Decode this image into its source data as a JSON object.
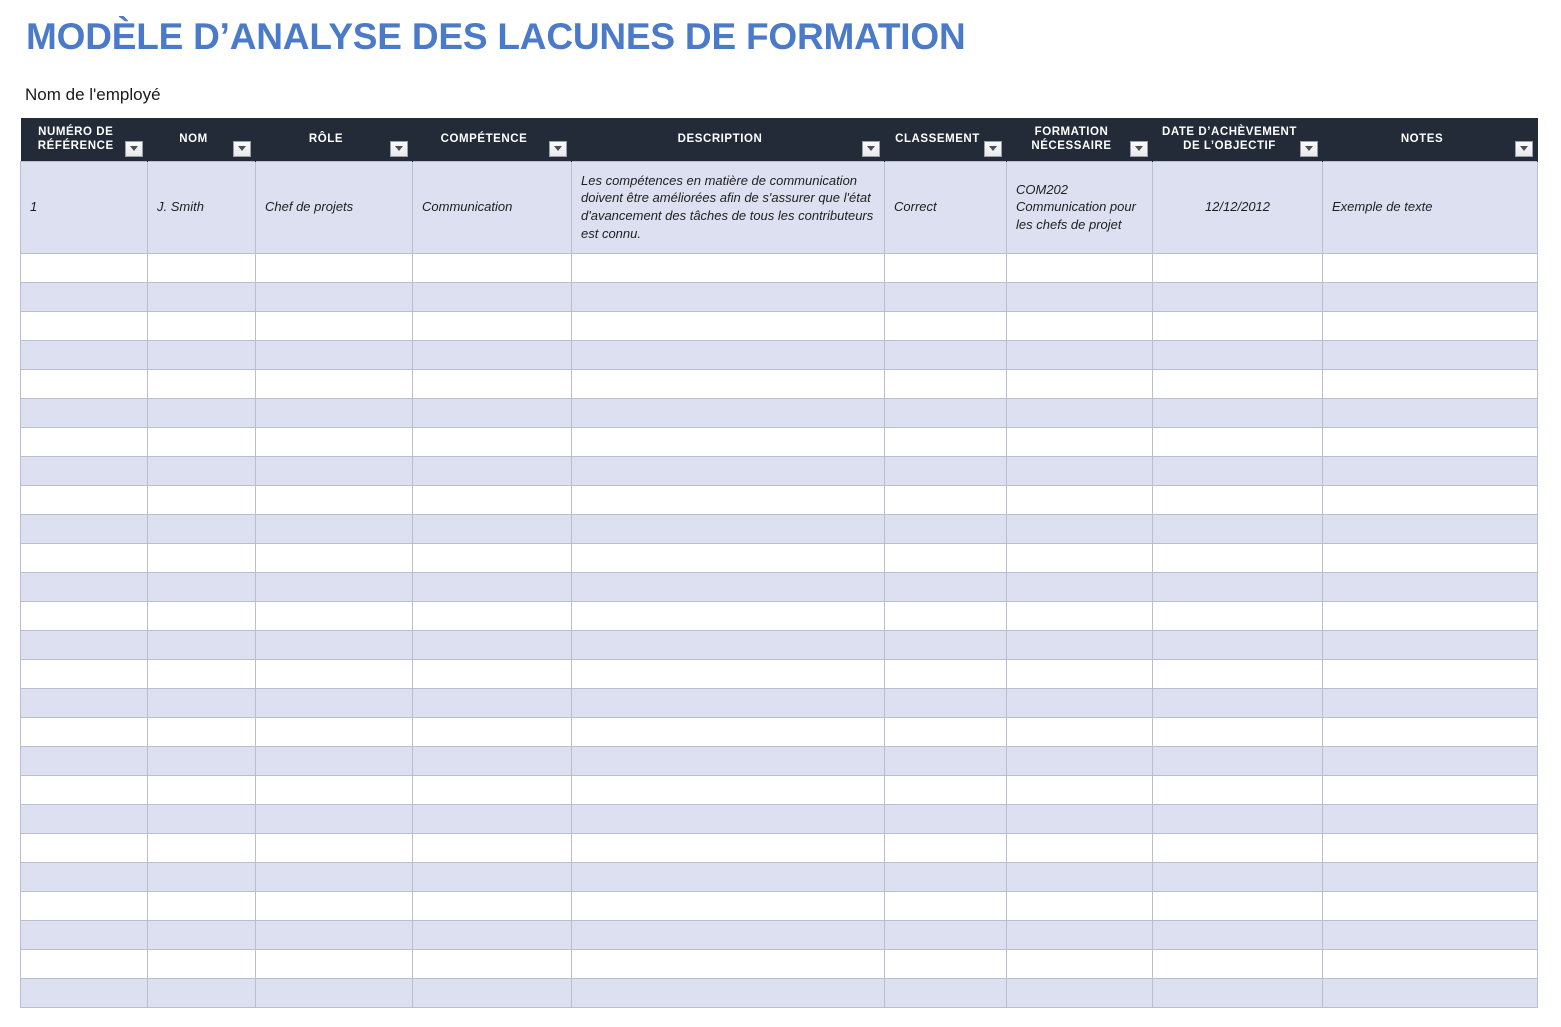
{
  "document": {
    "title": "MODÈLE D’ANALYSE DES LACUNES DE FORMATION",
    "employee_label": "Nom de l'employé"
  },
  "colors": {
    "title_blue": "#4a7ac8",
    "header_navy": "#242b38",
    "row_shaded": "#dce0f0",
    "row_plain": "#ffffff",
    "grid_line": "#b9bfd0"
  },
  "table": {
    "columns": [
      {
        "label": "NUMÉRO DE RÉFÉRENCE",
        "name": "numero-de-reference",
        "filter_icon": "filter-dropdown-icon"
      },
      {
        "label": "NOM",
        "name": "nom",
        "filter_icon": "filter-dropdown-icon"
      },
      {
        "label": "RÔLE",
        "name": "role",
        "filter_icon": "filter-dropdown-icon"
      },
      {
        "label": "COMPÉTENCE",
        "name": "competence",
        "filter_icon": "filter-dropdown-icon"
      },
      {
        "label": "DESCRIPTION",
        "name": "description",
        "filter_icon": "filter-dropdown-icon"
      },
      {
        "label": "CLASSEMENT",
        "name": "classement",
        "filter_icon": "filter-dropdown-icon"
      },
      {
        "label": "FORMATION NÉCESSAIRE",
        "name": "formation-necessaire",
        "filter_icon": "filter-dropdown-icon"
      },
      {
        "label": "DATE D’ACHÈVEMENT DE L’OBJECTIF",
        "name": "date-achevement-objectif",
        "filter_icon": "filter-dropdown-icon"
      },
      {
        "label": "NOTES",
        "name": "notes",
        "filter_icon": "filter-dropdown-icon"
      }
    ],
    "rows": [
      {
        "reference": "1",
        "nom": "J. Smith",
        "role": "Chef de projets",
        "competence": "Communication",
        "description": "Les compétences en matière de communication doivent être améliorées afin de s'assurer que l'état d'avancement des tâches de tous les contributeurs est connu.",
        "classement": "Correct",
        "formation": "COM202 Communication pour les chefs de projet",
        "date": "12/12/2012",
        "notes": "Exemple de texte"
      }
    ],
    "empty_row_count": 26
  }
}
